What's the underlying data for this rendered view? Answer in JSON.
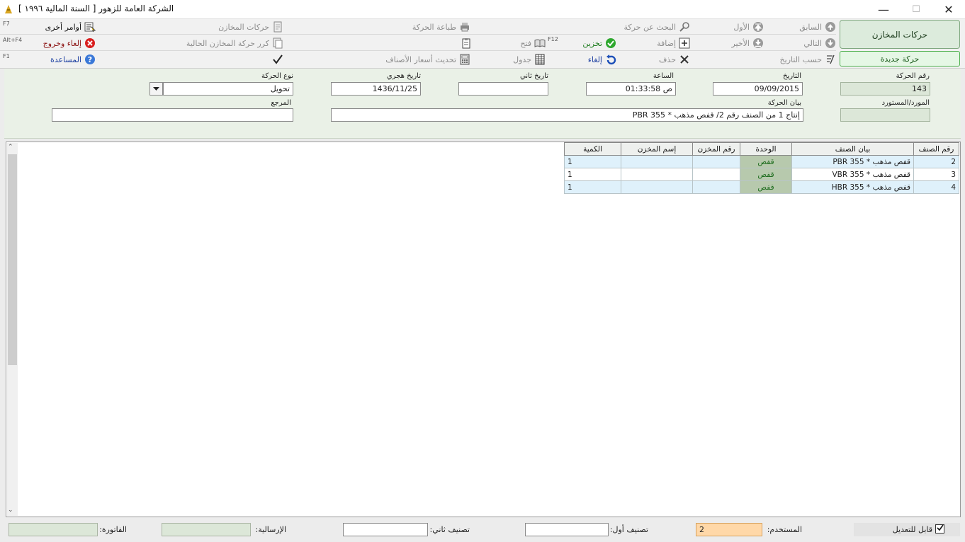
{
  "window": {
    "title": "الشركة العامة للزهور [ السنة المالية ١٩٩٦ ]",
    "minimize": "—",
    "maximize": "☐",
    "close": "✕"
  },
  "toolbar": {
    "warehouse_moves_button": "حركات المخازن",
    "new_move_button": "حركة جديدة",
    "row1": {
      "previous": "السابق",
      "first": "الأول",
      "search": "البحث عن حركة",
      "print": "طباعة الحركة",
      "warehouse_moves": "حركات المخازن",
      "other_commands": "أوامر أخرى",
      "fkey_other": "F7"
    },
    "row2": {
      "next": "التالي",
      "last": "الأخير",
      "add": "إضافة",
      "save": "تخزين",
      "open": "فتح",
      "fkey_open": "F12",
      "repeat_move": "كرر حركة المخازن الحالية",
      "cancel_exit": "إلغاء وخروج",
      "fkey_exit": "Alt+F4"
    },
    "row3": {
      "by_date": "حسب التاريخ",
      "delete": "حذف",
      "cancel": "إلغاء",
      "table": "جدول",
      "update_prices": "تحديث أسعار الأصناف",
      "help": "المساعدة",
      "fkey_help": "F1"
    }
  },
  "form": {
    "move_number_label": "رقم الحركة",
    "move_number": "143",
    "date_label": "التاريخ",
    "date": "09/09/2015",
    "time_label": "الساعة",
    "time": "01:33:58 ص",
    "second_date_label": "تاريخ ثاني",
    "second_date": "",
    "hijri_date_label": "تاريخ هجري",
    "hijri_date": "1436/11/25",
    "move_type_label": "نوع الحركة",
    "move_type": "تحويل",
    "supplier_label": "المورد/المستورد",
    "supplier": "",
    "description_label": "بيان الحركة",
    "description": "إنتاج 1 من الصنف رقم 2/ قفص مذهب * 355 PBR",
    "reference_label": "المرجع",
    "reference": ""
  },
  "grid": {
    "columns": [
      "رقم الصنف",
      "بيان الصنف",
      "الوحدة",
      "رقم المخزن",
      "إسم المخزن",
      "الكمية"
    ],
    "rows": [
      {
        "item_no": "2",
        "item_desc": "قفص مذهب * 355 PBR",
        "unit": "قفص",
        "store_no": "",
        "store_name": "",
        "qty": "1"
      },
      {
        "item_no": "3",
        "item_desc": "قفص مذهب * 355 VBR",
        "unit": "قفص",
        "store_no": "",
        "store_name": "",
        "qty": "1"
      },
      {
        "item_no": "4",
        "item_desc": "قفص مذهب * 355 HBR",
        "unit": "قفص",
        "store_no": "",
        "store_name": "",
        "qty": "1"
      }
    ]
  },
  "status": {
    "editable_label": "قابل للتعديل",
    "editable_checked": true,
    "user_label": "المستخدم:",
    "user": "2",
    "class1_label": "تصنيف أول:",
    "class1": "",
    "class2_label": "تصنيف ثاني:",
    "class2": "",
    "dispatch_label": "الإرسالية:",
    "dispatch": "",
    "invoice_label": "الفاتورة:",
    "invoice": ""
  }
}
